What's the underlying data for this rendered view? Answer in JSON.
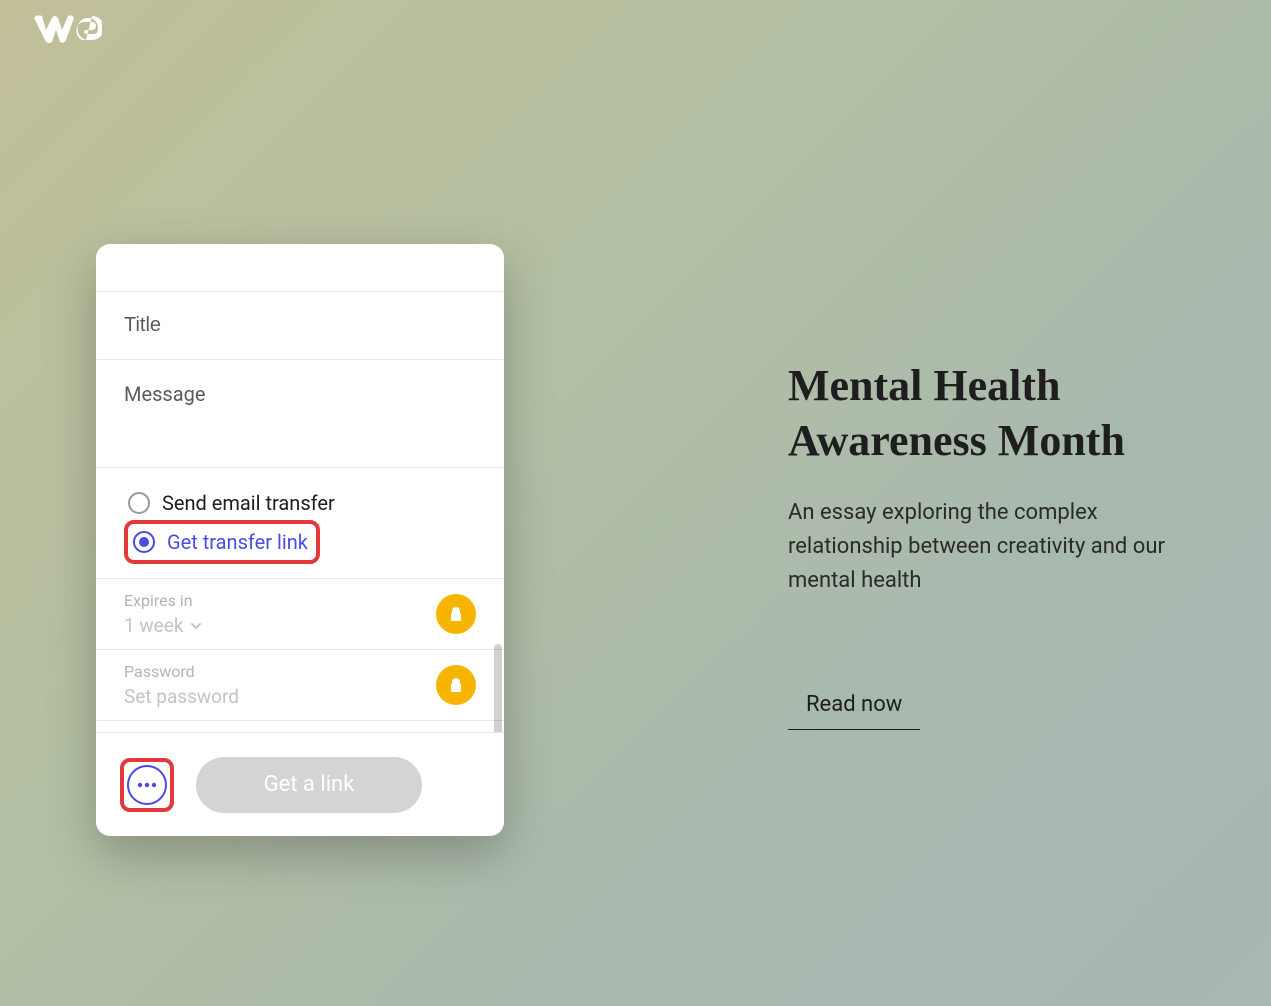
{
  "logo": {
    "alt": "WeTransfer"
  },
  "promo": {
    "title": "Mental Health Awareness Month",
    "subtitle": "An essay exploring the complex relationship between creativity and our mental health",
    "cta": "Read now"
  },
  "panel": {
    "title_placeholder": "Title",
    "message_placeholder": "Message",
    "radios": {
      "email": "Send email transfer",
      "link": "Get transfer link",
      "selected": "link"
    },
    "expires": {
      "label": "Expires in",
      "value": "1 week"
    },
    "password": {
      "label": "Password",
      "placeholder": "Set password"
    },
    "submit_label": "Get a link"
  },
  "icons": {
    "lock": "lock-icon",
    "more": "more-icon",
    "chevron_down": "chevron-down-icon"
  }
}
